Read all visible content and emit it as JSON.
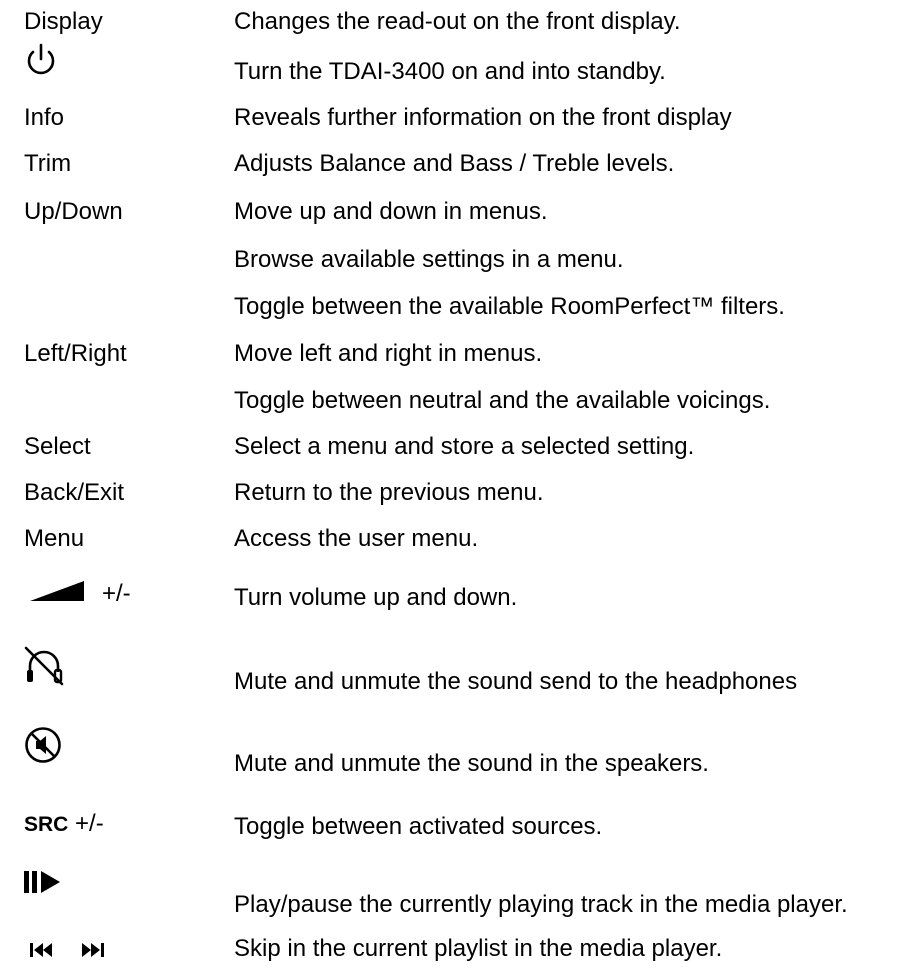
{
  "rows": {
    "display": {
      "key": "Display",
      "desc": "Changes the read-out on the front display."
    },
    "power": {
      "icon": "power-icon",
      "desc": "Turn the TDAI-3400 on and into standby."
    },
    "info": {
      "key": "Info",
      "desc": "Reveals further information on the front display"
    },
    "trim": {
      "key": "Trim",
      "desc": "Adjusts Balance and Bass / Treble levels."
    },
    "updown": {
      "key": "Up/Down",
      "desc": "Move up and down in menus.",
      "desc2": "Browse available settings in a menu.",
      "desc3": "Toggle between the available RoomPerfect™ filters."
    },
    "leftright": {
      "key": "Left/Right",
      "desc": "Move left and right in menus.",
      "desc2": "Toggle between neutral and the available voicings."
    },
    "select": {
      "key": "Select",
      "desc": "Select a menu and store a selected setting."
    },
    "back": {
      "key": "Back/Exit",
      "desc": "Return to the previous menu."
    },
    "menu": {
      "key": "Menu",
      "desc": "Access the user menu."
    },
    "volume": {
      "icon": "volume-ramp-icon",
      "suffix": "+/-",
      "desc": "Turn volume up and down."
    },
    "headphones_mute": {
      "icon": "headphones-mute-icon",
      "desc": "Mute and unmute the sound send to the headphones"
    },
    "speaker_mute": {
      "icon": "speaker-mute-icon",
      "desc": "Mute and unmute the sound in the speakers."
    },
    "src": {
      "key_bold": "SRC",
      "suffix": "+/-",
      "desc": "Toggle between activated sources."
    },
    "playpause": {
      "icon": "play-pause-icon",
      "desc": "Play/pause the currently playing track in the media player."
    },
    "skip": {
      "icon": "skip-icon",
      "desc": "Skip in the current playlist in the media player."
    }
  }
}
